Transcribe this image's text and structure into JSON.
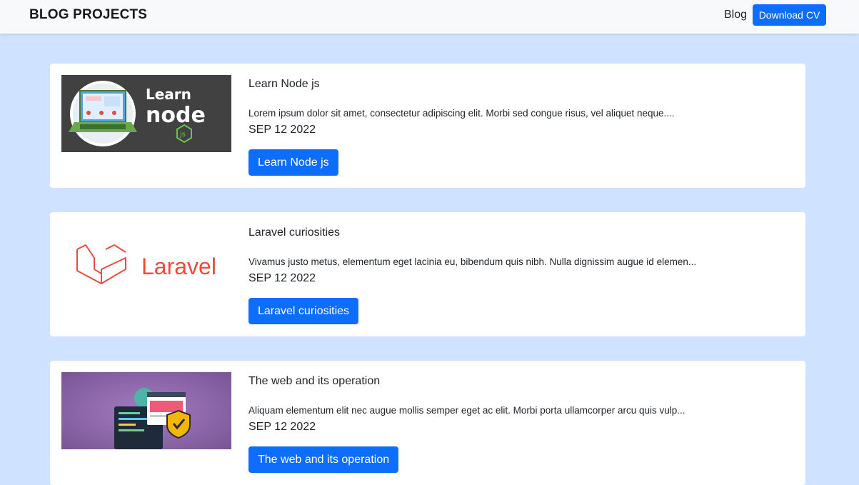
{
  "navbar": {
    "brand": "BLOG PROJECTS",
    "blog_link": "Blog",
    "download_cv": "Download CV"
  },
  "posts": [
    {
      "title": "Learn Node js",
      "excerpt": "Lorem ipsum dolor sit amet, consectetur adipiscing elit. Morbi sed congue risus, vel aliquet neque....",
      "date": "SEP 12 2022",
      "button": "Learn Node js",
      "image_text": [
        "Learn",
        "node",
        "js"
      ]
    },
    {
      "title": "Laravel curiosities",
      "excerpt": "Vivamus justo metus, elementum eget lacinia eu, bibendum quis nibh. Nulla dignissim augue id elemen...",
      "date": "SEP 12 2022",
      "button": "Laravel curiosities",
      "image_text": [
        "Laravel"
      ]
    },
    {
      "title": "The web and its operation",
      "excerpt": "Aliquam elementum elit nec augue mollis semper eget ac elit. Morbi porta ullamcorper arcu quis vulp...",
      "date": "SEP 12 2022",
      "button": "The web and its operation"
    }
  ],
  "colors": {
    "page_bg": "#cfe2ff",
    "primary": "#0d6efd",
    "navbar_bg": "#f8f9fa",
    "laravel_red": "#ef4a3c",
    "node_green": "#6cc24a"
  }
}
